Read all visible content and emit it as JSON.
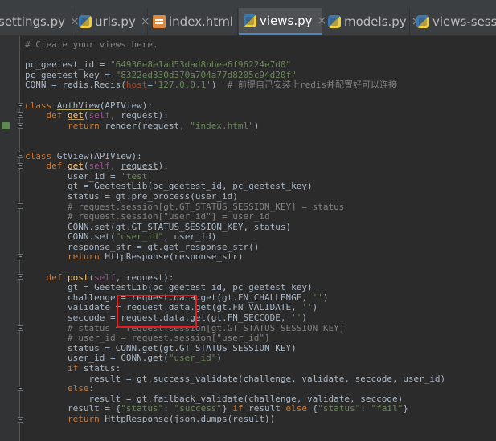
{
  "tabs": [
    {
      "label": "settings.py",
      "icon": "python-file-icon",
      "active": false
    },
    {
      "label": "urls.py",
      "icon": "python-file-icon",
      "active": false
    },
    {
      "label": "index.html",
      "icon": "html-file-icon",
      "active": false
    },
    {
      "label": "views.py",
      "icon": "python-file-icon",
      "active": true
    },
    {
      "label": "models.py",
      "icon": "python-file-icon",
      "active": false
    },
    {
      "label": "views-session",
      "icon": "python-file-icon",
      "active": false
    }
  ],
  "close_glyph": "×",
  "colors": {
    "background": "#2b2b2b",
    "keyword": "#cc7832",
    "string": "#6a8759",
    "comment": "#808080",
    "function": "#ffc66d",
    "highlight_box": "#e02020"
  },
  "code": [
    [
      [
        "c",
        "# Create your views here."
      ]
    ],
    [],
    [
      [
        "t",
        "pc_geetest_id = "
      ],
      [
        "s",
        "\"64936e8e1ad53dad8bbee6f96224e7d0\""
      ]
    ],
    [
      [
        "t",
        "pc_geetest_key = "
      ],
      [
        "s",
        "\"8322ed330d370a704a77d8205c94d20f\""
      ]
    ],
    [
      [
        "t",
        "CONN = redis.Redis("
      ],
      [
        "p",
        "host"
      ],
      [
        "t",
        "="
      ],
      [
        "s",
        "'127.0.0.1'"
      ],
      [
        "t",
        ")  "
      ],
      [
        "c",
        "# 前提自己安装上redis并配置好可以连接"
      ]
    ],
    [],
    [
      [
        "k",
        "class "
      ],
      [
        "u",
        "AuthView"
      ],
      [
        "t",
        "(APIView):"
      ]
    ],
    [
      [
        "t",
        "    "
      ],
      [
        "k",
        "def "
      ],
      [
        "fu",
        "get"
      ],
      [
        "t",
        "("
      ],
      [
        "sl",
        "self"
      ],
      [
        "t",
        ", request):"
      ]
    ],
    [
      [
        "t",
        "        "
      ],
      [
        "k",
        "return "
      ],
      [
        "t",
        "render(request, "
      ],
      [
        "s",
        "\"index.html\""
      ],
      [
        "t",
        ")"
      ]
    ],
    [],
    [],
    [
      [
        "k",
        "class "
      ],
      [
        "t",
        "GtView(APIView):"
      ]
    ],
    [
      [
        "t",
        "    "
      ],
      [
        "k",
        "def "
      ],
      [
        "fu",
        "get"
      ],
      [
        "t",
        "("
      ],
      [
        "sl",
        "self"
      ],
      [
        "t",
        ", "
      ],
      [
        "u",
        "request"
      ],
      [
        "t",
        "):"
      ]
    ],
    [
      [
        "t",
        "        user_id = "
      ],
      [
        "s",
        "'test'"
      ]
    ],
    [
      [
        "t",
        "        gt = GeetestLib(pc_geetest_id, pc_geetest_key)"
      ]
    ],
    [
      [
        "t",
        "        status = gt.pre_process(user_id)"
      ]
    ],
    [
      [
        "t",
        "        "
      ],
      [
        "c",
        "# request.session[gt.GT_STATUS_SESSION_KEY] = status"
      ]
    ],
    [
      [
        "t",
        "        "
      ],
      [
        "c",
        "# request.session[\"user_id\"] = user_id"
      ]
    ],
    [
      [
        "t",
        "        CONN.set(gt.GT_STATUS_SESSION_KEY, status)"
      ]
    ],
    [
      [
        "t",
        "        CONN.set("
      ],
      [
        "s",
        "\"user_id\""
      ],
      [
        "t",
        ", user_id)"
      ]
    ],
    [
      [
        "t",
        "        response_str = gt.get_response_str()"
      ]
    ],
    [
      [
        "t",
        "        "
      ],
      [
        "k",
        "return "
      ],
      [
        "t",
        "HttpResponse(response_str)"
      ]
    ],
    [],
    [
      [
        "t",
        "    "
      ],
      [
        "k",
        "def "
      ],
      [
        "f",
        "post"
      ],
      [
        "t",
        "("
      ],
      [
        "sl",
        "self"
      ],
      [
        "t",
        ", request):"
      ]
    ],
    [
      [
        "t",
        "        gt = GeetestLib(pc_geetest_id, pc_geetest_key)"
      ]
    ],
    [
      [
        "t",
        "        challenge = request.data.get(gt.FN_CHALLENGE, "
      ],
      [
        "s",
        "''"
      ],
      [
        "t",
        ")"
      ]
    ],
    [
      [
        "t",
        "        validate = request.data.get(gt.FN_VALIDATE, "
      ],
      [
        "s",
        "''"
      ],
      [
        "t",
        ")"
      ]
    ],
    [
      [
        "t",
        "        seccode = request.data.get(gt.FN_SECCODE, "
      ],
      [
        "s",
        "''"
      ],
      [
        "t",
        ")"
      ]
    ],
    [
      [
        "t",
        "        "
      ],
      [
        "c",
        "# status = request.session[gt.GT_STATUS_SESSION_KEY]"
      ]
    ],
    [
      [
        "t",
        "        "
      ],
      [
        "c",
        "# user_id = request.session[\"user_id\"]"
      ]
    ],
    [
      [
        "t",
        "        status = CONN.get(gt.GT_STATUS_SESSION_KEY)"
      ]
    ],
    [
      [
        "t",
        "        user_id = CONN.get("
      ],
      [
        "s",
        "\"user_id\""
      ],
      [
        "t",
        ")"
      ]
    ],
    [
      [
        "t",
        "        "
      ],
      [
        "k",
        "if "
      ],
      [
        "t",
        "status:"
      ]
    ],
    [
      [
        "t",
        "            result = gt.success_validate(challenge, validate, seccode, user_id)"
      ]
    ],
    [
      [
        "t",
        "        "
      ],
      [
        "k",
        "else"
      ],
      [
        "t",
        ":"
      ]
    ],
    [
      [
        "t",
        "            result = gt.failback_validate(challenge, validate, seccode)"
      ]
    ],
    [
      [
        "t",
        "        result = {"
      ],
      [
        "s",
        "\"status\""
      ],
      [
        "t",
        ": "
      ],
      [
        "s",
        "\"success\""
      ],
      [
        "t",
        "} "
      ],
      [
        "k",
        "if "
      ],
      [
        "t",
        "result "
      ],
      [
        "k",
        "else "
      ],
      [
        "t",
        "{"
      ],
      [
        "s",
        "\"status\""
      ],
      [
        "t",
        ": "
      ],
      [
        "s",
        "\"fail\""
      ],
      [
        "t",
        "}"
      ]
    ],
    [
      [
        "t",
        "        "
      ],
      [
        "k",
        "return "
      ],
      [
        "t",
        "HttpResponse(json.dumps(result))"
      ]
    ]
  ]
}
